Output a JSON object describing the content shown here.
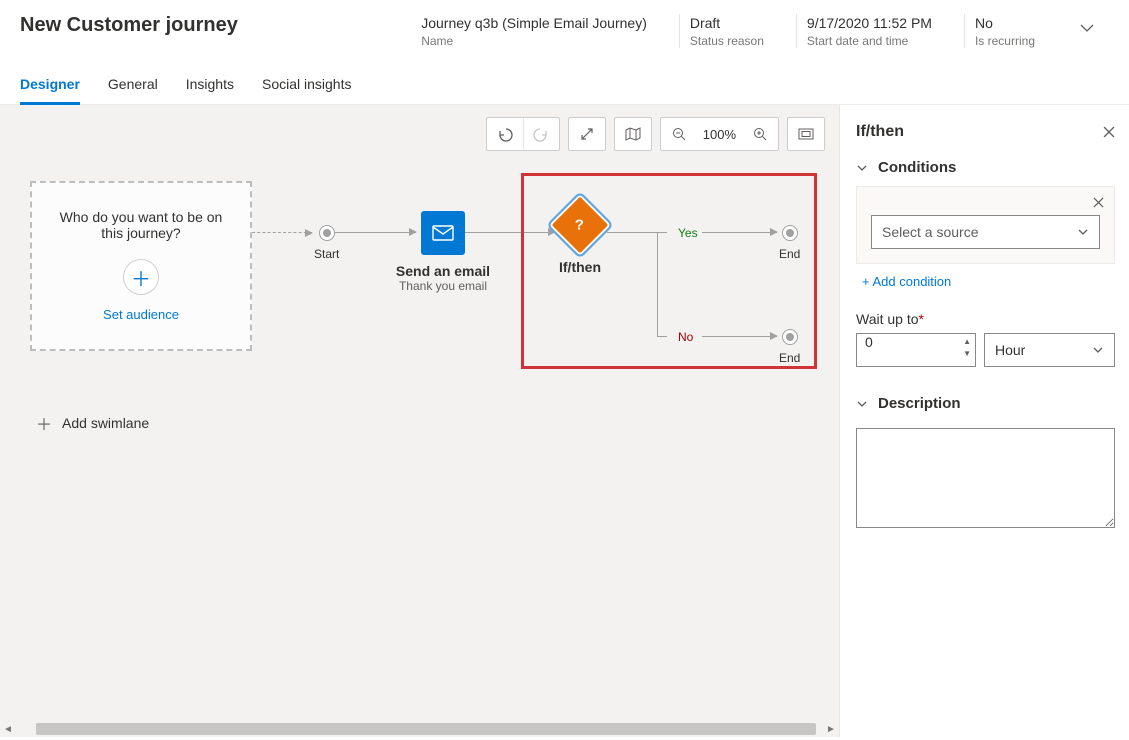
{
  "page_title": "New Customer journey",
  "header_meta": [
    {
      "value": "Journey q3b (Simple Email Journey)",
      "label": "Name"
    },
    {
      "value": "Draft",
      "label": "Status reason"
    },
    {
      "value": "9/17/2020 11:52 PM",
      "label": "Start date and time"
    },
    {
      "value": "No",
      "label": "Is recurring"
    }
  ],
  "tabs": [
    "Designer",
    "General",
    "Insights",
    "Social insights"
  ],
  "active_tab_index": 0,
  "toolbar": {
    "zoom": "100%"
  },
  "canvas": {
    "audience_question": "Who do you want to be on this journey?",
    "set_audience": "Set audience",
    "start_label": "Start",
    "email_title": "Send an email",
    "email_subtitle": "Thank you email",
    "ifthen_title": "If/then",
    "branch_yes": "Yes",
    "branch_no": "No",
    "end_label": "End",
    "add_swimlane": "Add swimlane"
  },
  "panel": {
    "title": "If/then",
    "section_conditions": "Conditions",
    "select_source_placeholder": "Select a source",
    "add_condition": "+ Add condition",
    "wait_label": "Wait up to",
    "wait_value": "0",
    "wait_unit": "Hour",
    "section_description": "Description",
    "description_value": ""
  }
}
